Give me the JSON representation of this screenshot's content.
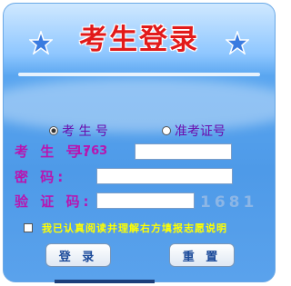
{
  "header": {
    "title": "考生登录"
  },
  "login_type": {
    "options": [
      {
        "label": "考 生 号",
        "selected": true
      },
      {
        "label": "准考证号",
        "selected": false
      }
    ]
  },
  "form": {
    "examinee_id_label": "考 生 号:",
    "examinee_id_prefix": "1763",
    "password_label": "密    码:",
    "captcha_label": "验 证 码:",
    "captcha_code": "1681"
  },
  "agreement": {
    "text": "我已认真阅读并理解右方填报志愿说明"
  },
  "buttons": {
    "login": "登 录",
    "reset": "重 置"
  },
  "colors": {
    "title": "#e21a1a",
    "labels": "#b815b0",
    "agreement": "#ffff00",
    "panel": "#4e9ae8"
  }
}
